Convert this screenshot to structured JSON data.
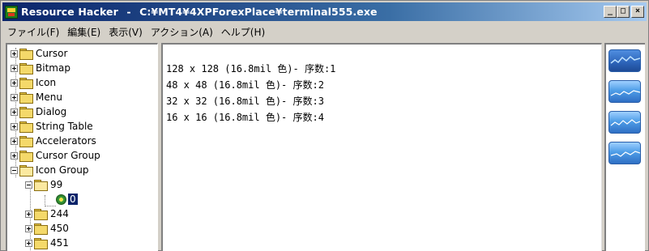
{
  "window": {
    "app_title": "Resource Hacker",
    "separator": "-",
    "file_path": "C:¥MT4¥4XPForexPlace¥terminal555.exe",
    "buttons": {
      "minimize": "_",
      "maximize": "□",
      "close": "×"
    }
  },
  "menu": [
    "ファイル(F)",
    "編集(E)",
    "表示(V)",
    "アクション(A)",
    "ヘルプ(H)"
  ],
  "tree": {
    "nodes": [
      {
        "label": "Cursor"
      },
      {
        "label": "Bitmap"
      },
      {
        "label": "Icon"
      },
      {
        "label": "Menu"
      },
      {
        "label": "Dialog"
      },
      {
        "label": "String Table"
      },
      {
        "label": "Accelerators"
      },
      {
        "label": "Cursor Group"
      },
      {
        "label": "Icon Group"
      }
    ],
    "icon_group_children": [
      {
        "label": "99",
        "leaf": "0"
      },
      {
        "label": "244"
      },
      {
        "label": "450"
      },
      {
        "label": "451"
      }
    ]
  },
  "content": {
    "lines": [
      "128 x 128 (16.8mil 色)- 序数:1",
      "48 x 48 (16.8mil 色)- 序数:2",
      "32 x 32 (16.8mil 色)- 序数:3",
      "16 x 16 (16.8mil 色)- 序数:4"
    ]
  },
  "icon_preview": {
    "thumbnails": [
      "chart-thumbnail-128",
      "chart-thumbnail-48",
      "chart-thumbnail-32",
      "chart-thumbnail-16"
    ]
  }
}
